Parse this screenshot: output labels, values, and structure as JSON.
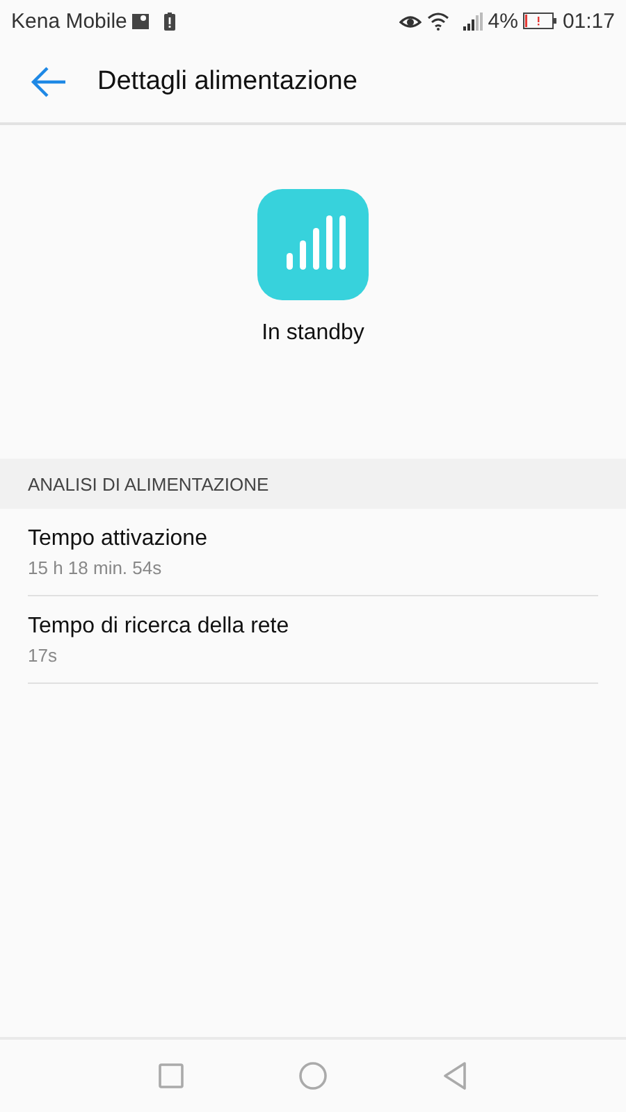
{
  "status_bar": {
    "carrier": "Kena Mobile",
    "battery_percent": "4%",
    "time": "01:17"
  },
  "header": {
    "title": "Dettagli alimentazione"
  },
  "hero": {
    "label": "In standby"
  },
  "section": {
    "title": "ANALISI DI ALIMENTAZIONE",
    "rows": [
      {
        "title": "Tempo attivazione",
        "value": "15 h 18 min. 54s"
      },
      {
        "title": "Tempo di ricerca della rete",
        "value": "17s"
      }
    ]
  }
}
